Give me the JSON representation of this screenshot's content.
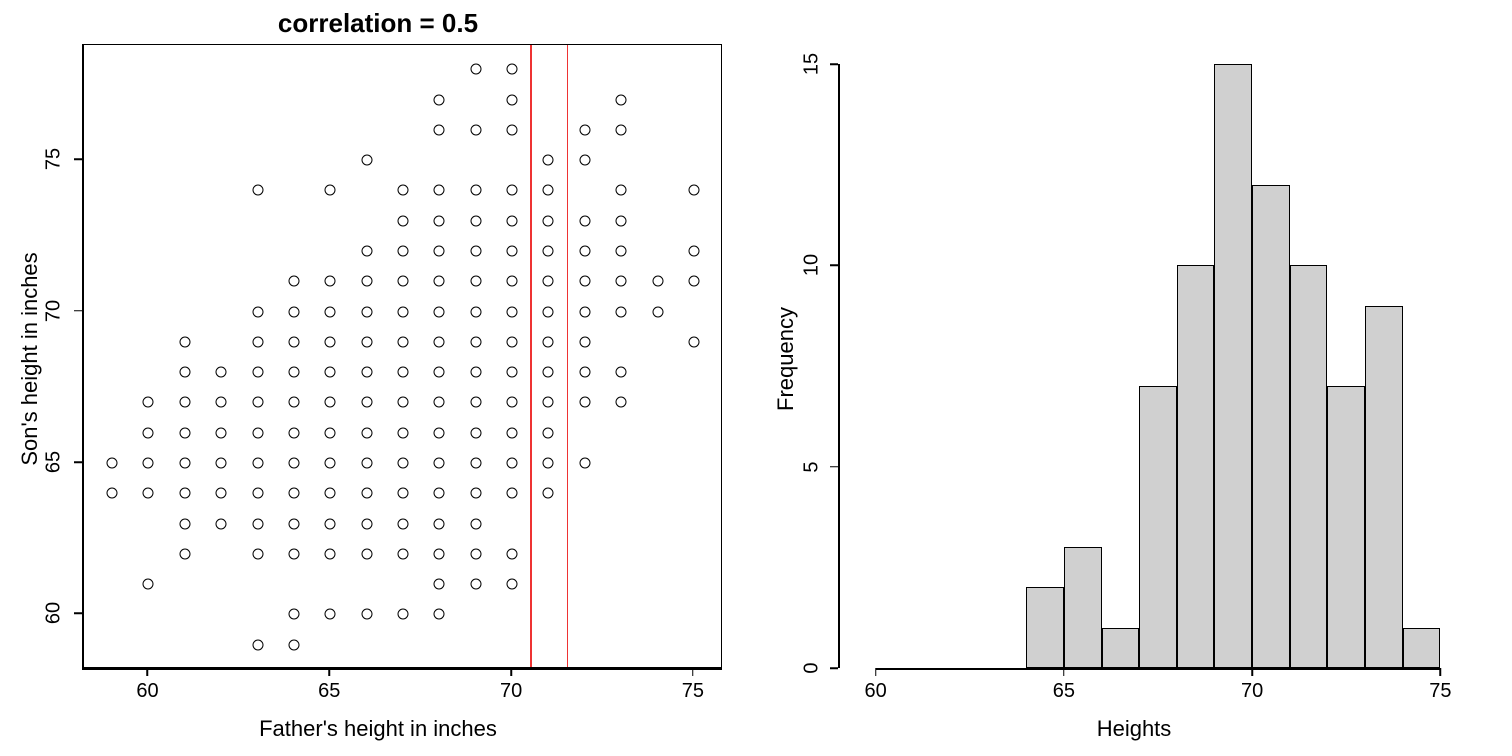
{
  "chart_data": [
    {
      "type": "scatter",
      "title": "correlation = 0.5",
      "xlabel": "Father's height in inches",
      "ylabel": "Son's height in inches",
      "xlim": [
        58.2,
        75.8
      ],
      "ylim": [
        58.2,
        78.8
      ],
      "xticks": [
        60,
        65,
        70,
        75
      ],
      "yticks": [
        60,
        65,
        70,
        75
      ],
      "vlines": [
        70.5,
        71.5
      ],
      "points": [
        [
          59,
          64
        ],
        [
          59,
          65
        ],
        [
          60,
          61
        ],
        [
          60,
          64
        ],
        [
          60,
          65
        ],
        [
          60,
          66
        ],
        [
          60,
          67
        ],
        [
          61,
          62
        ],
        [
          61,
          63
        ],
        [
          61,
          64
        ],
        [
          61,
          65
        ],
        [
          61,
          66
        ],
        [
          61,
          67
        ],
        [
          61,
          68
        ],
        [
          61,
          69
        ],
        [
          62,
          63
        ],
        [
          62,
          64
        ],
        [
          62,
          65
        ],
        [
          62,
          66
        ],
        [
          62,
          67
        ],
        [
          62,
          68
        ],
        [
          63,
          59
        ],
        [
          63,
          62
        ],
        [
          63,
          63
        ],
        [
          63,
          64
        ],
        [
          63,
          65
        ],
        [
          63,
          66
        ],
        [
          63,
          67
        ],
        [
          63,
          68
        ],
        [
          63,
          69
        ],
        [
          63,
          70
        ],
        [
          63,
          74
        ],
        [
          64,
          59
        ],
        [
          64,
          60
        ],
        [
          64,
          62
        ],
        [
          64,
          63
        ],
        [
          64,
          64
        ],
        [
          64,
          65
        ],
        [
          64,
          66
        ],
        [
          64,
          67
        ],
        [
          64,
          68
        ],
        [
          64,
          69
        ],
        [
          64,
          70
        ],
        [
          64,
          71
        ],
        [
          65,
          60
        ],
        [
          65,
          62
        ],
        [
          65,
          63
        ],
        [
          65,
          64
        ],
        [
          65,
          65
        ],
        [
          65,
          66
        ],
        [
          65,
          67
        ],
        [
          65,
          68
        ],
        [
          65,
          69
        ],
        [
          65,
          70
        ],
        [
          65,
          71
        ],
        [
          65,
          74
        ],
        [
          66,
          60
        ],
        [
          66,
          62
        ],
        [
          66,
          63
        ],
        [
          66,
          64
        ],
        [
          66,
          65
        ],
        [
          66,
          66
        ],
        [
          66,
          67
        ],
        [
          66,
          68
        ],
        [
          66,
          69
        ],
        [
          66,
          70
        ],
        [
          66,
          71
        ],
        [
          66,
          72
        ],
        [
          66,
          75
        ],
        [
          67,
          60
        ],
        [
          67,
          62
        ],
        [
          67,
          63
        ],
        [
          67,
          64
        ],
        [
          67,
          65
        ],
        [
          67,
          66
        ],
        [
          67,
          67
        ],
        [
          67,
          68
        ],
        [
          67,
          69
        ],
        [
          67,
          70
        ],
        [
          67,
          71
        ],
        [
          67,
          72
        ],
        [
          67,
          73
        ],
        [
          67,
          74
        ],
        [
          68,
          60
        ],
        [
          68,
          61
        ],
        [
          68,
          62
        ],
        [
          68,
          63
        ],
        [
          68,
          64
        ],
        [
          68,
          65
        ],
        [
          68,
          66
        ],
        [
          68,
          67
        ],
        [
          68,
          68
        ],
        [
          68,
          69
        ],
        [
          68,
          70
        ],
        [
          68,
          71
        ],
        [
          68,
          72
        ],
        [
          68,
          73
        ],
        [
          68,
          74
        ],
        [
          68,
          76
        ],
        [
          68,
          77
        ],
        [
          69,
          61
        ],
        [
          69,
          62
        ],
        [
          69,
          63
        ],
        [
          69,
          64
        ],
        [
          69,
          65
        ],
        [
          69,
          66
        ],
        [
          69,
          67
        ],
        [
          69,
          68
        ],
        [
          69,
          69
        ],
        [
          69,
          70
        ],
        [
          69,
          71
        ],
        [
          69,
          72
        ],
        [
          69,
          73
        ],
        [
          69,
          74
        ],
        [
          69,
          76
        ],
        [
          69,
          78
        ],
        [
          70,
          61
        ],
        [
          70,
          62
        ],
        [
          70,
          64
        ],
        [
          70,
          65
        ],
        [
          70,
          66
        ],
        [
          70,
          67
        ],
        [
          70,
          68
        ],
        [
          70,
          69
        ],
        [
          70,
          70
        ],
        [
          70,
          71
        ],
        [
          70,
          72
        ],
        [
          70,
          73
        ],
        [
          70,
          74
        ],
        [
          70,
          76
        ],
        [
          70,
          77
        ],
        [
          70,
          78
        ],
        [
          71,
          64
        ],
        [
          71,
          65
        ],
        [
          71,
          66
        ],
        [
          71,
          67
        ],
        [
          71,
          68
        ],
        [
          71,
          69
        ],
        [
          71,
          70
        ],
        [
          71,
          71
        ],
        [
          71,
          72
        ],
        [
          71,
          73
        ],
        [
          71,
          74
        ],
        [
          71,
          75
        ],
        [
          72,
          65
        ],
        [
          72,
          67
        ],
        [
          72,
          68
        ],
        [
          72,
          69
        ],
        [
          72,
          70
        ],
        [
          72,
          71
        ],
        [
          72,
          72
        ],
        [
          72,
          73
        ],
        [
          72,
          75
        ],
        [
          72,
          76
        ],
        [
          73,
          67
        ],
        [
          73,
          68
        ],
        [
          73,
          70
        ],
        [
          73,
          71
        ],
        [
          73,
          72
        ],
        [
          73,
          73
        ],
        [
          73,
          74
        ],
        [
          73,
          76
        ],
        [
          73,
          77
        ],
        [
          74,
          70
        ],
        [
          74,
          71
        ],
        [
          75,
          69
        ],
        [
          75,
          71
        ],
        [
          75,
          72
        ],
        [
          75,
          74
        ]
      ]
    },
    {
      "type": "bar",
      "title": "",
      "xlabel": "Heights",
      "ylabel": "Frequency",
      "xlim": [
        59,
        76
      ],
      "ylim": [
        0,
        15.5
      ],
      "xticks": [
        60,
        65,
        70,
        75
      ],
      "yticks": [
        0,
        5,
        10,
        15
      ],
      "bin_width": 1,
      "bins": [
        {
          "x0": 64,
          "x1": 65,
          "count": 2
        },
        {
          "x0": 65,
          "x1": 66,
          "count": 3
        },
        {
          "x0": 66,
          "x1": 67,
          "count": 1
        },
        {
          "x0": 67,
          "x1": 68,
          "count": 7
        },
        {
          "x0": 68,
          "x1": 69,
          "count": 10
        },
        {
          "x0": 69,
          "x1": 70,
          "count": 15
        },
        {
          "x0": 70,
          "x1": 71,
          "count": 12
        },
        {
          "x0": 71,
          "x1": 72,
          "count": 10
        },
        {
          "x0": 72,
          "x1": 73,
          "count": 7
        },
        {
          "x0": 73,
          "x1": 74,
          "count": 9
        },
        {
          "x0": 74,
          "x1": 75,
          "count": 1
        }
      ]
    }
  ]
}
